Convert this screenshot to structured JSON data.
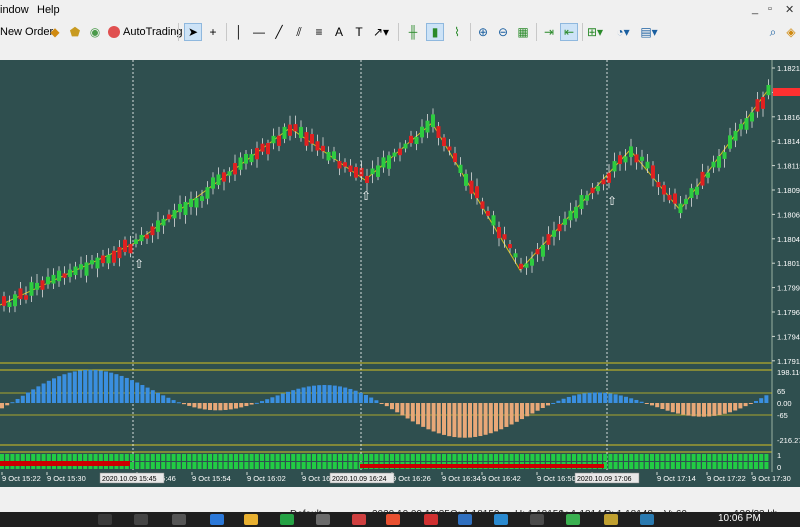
{
  "menu": {
    "window_label": "indow",
    "help_label": "Help"
  },
  "toolbar": {
    "new_order_label": "New Order",
    "autotrading_label": "AutoTrading",
    "text_tool_label": "A"
  },
  "chart": {
    "price_ticks": [
      "1.18215",
      "1.18190",
      "1.18165",
      "1.18140",
      "1.18115",
      "1.18090",
      "1.18065",
      "1.18040",
      "1.18015",
      "1.17990",
      "1.17965",
      "1.17940",
      "1.17915"
    ],
    "current_price_color": "#ff3030",
    "osc_ticks": [
      "198.116",
      "65",
      "0.00",
      "-65",
      "-216.271"
    ],
    "bar_ticks": [
      "1",
      "0"
    ],
    "time_labels": [
      "9 Oct 15:22",
      "9 Oct 15:30",
      "9 Oct 15:46",
      "9 Oct 15:54",
      "9 Oct 16:02",
      "9 Oct 16:10",
      "9 Oct 16:26",
      "9 Oct 16:34",
      "9 Oct 16:42",
      "9 Oct 16:50",
      "9 Oct 16:58",
      "9 Oct 17:14",
      "9 Oct 17:22",
      "9 Oct 17:30"
    ],
    "time_markers": [
      "2020.10.09 15:45",
      "2020.10.09 16:24",
      "2020.10.09 17:06"
    ],
    "colors": {
      "background": "#2f4f4f",
      "bull": "#2ecc40",
      "bear": "#e02020",
      "zigzag": "#d4c020",
      "osc_pos": "#3a8fe0",
      "osc_neg": "#e8a878",
      "grid_line": "#d4c020"
    }
  },
  "status": {
    "profile": "Default",
    "datetime": "2020.10.09 16:35",
    "open": "O: 1.18150",
    "high": "H: 1.18158",
    "low": "L: 1.18144",
    "close": "C: 1.18148",
    "volume": "V: 60",
    "traffic": "130/23 kb"
  },
  "taskbar": {
    "clock": "10:06 PM"
  }
}
